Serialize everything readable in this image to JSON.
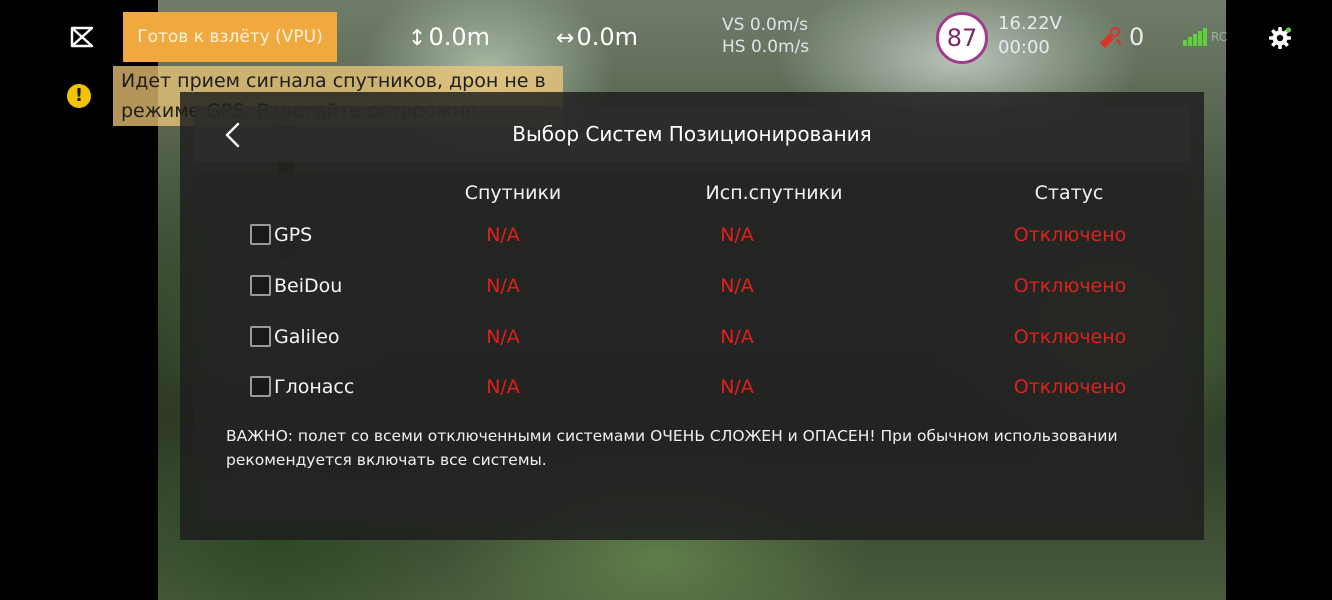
{
  "status_bar": {
    "ready_label": "Готов к взлёту (VPU)",
    "altitude": "0.0m",
    "distance": "0.0m",
    "vertical_speed": "VS 0.0m/s",
    "horizontal_speed": "HS 0.0m/s",
    "battery_percent": "87",
    "voltage": "16.22V",
    "flight_time": "00:00",
    "rc_value": "0",
    "signal_label": "RC"
  },
  "warning": {
    "text": "Идет прием сигнала спутников, дрон не в режиме GPS. Взлетайте осторожно."
  },
  "modal": {
    "title": "Выбор Систем Позиционирования",
    "columns": {
      "satellites": "Спутники",
      "used_satellites": "Исп.спутники",
      "status": "Статус"
    },
    "systems": [
      {
        "name": "GPS",
        "satellites": "N/A",
        "used": "N/A",
        "status": "Отключено"
      },
      {
        "name": "BeiDou",
        "satellites": "N/A",
        "used": "N/A",
        "status": "Отключено"
      },
      {
        "name": "Galileo",
        "satellites": "N/A",
        "used": "N/A",
        "status": "Отключено"
      },
      {
        "name": "Глонасс",
        "satellites": "N/A",
        "used": "N/A",
        "status": "Отключено"
      }
    ],
    "note": "ВАЖНО: полет со всеми отключенными системами ОЧЕНЬ СЛОЖЕН и ОПАСЕН! При обычном использовании рекомендуется включать все системы."
  },
  "colors": {
    "ready_bg": "#f0a93e",
    "disabled_red": "#e0201d",
    "battery_ring": "#a13c8c",
    "signal_green": "#5fcf3c",
    "warning_yellow": "#f2c400"
  }
}
